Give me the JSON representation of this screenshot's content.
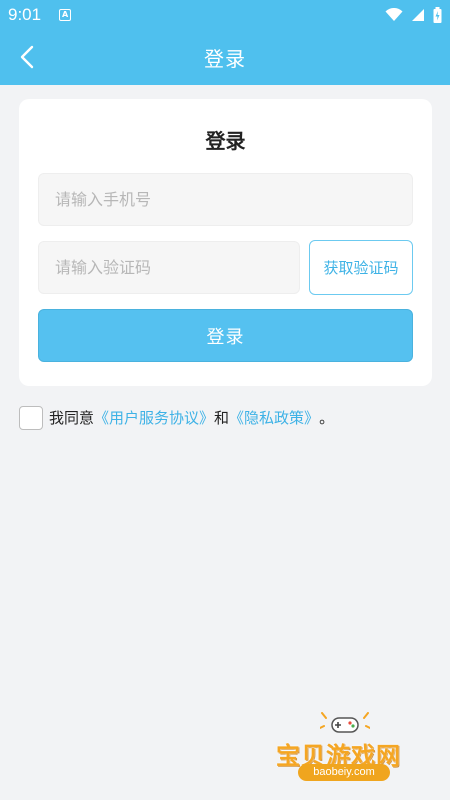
{
  "status_bar": {
    "time": "9:01",
    "notification_icon": "a-notification-icon",
    "icons": [
      "wifi-icon",
      "signal-icon",
      "battery-icon"
    ]
  },
  "app_bar": {
    "title": "登录",
    "back_icon": "chevron-left-icon"
  },
  "card": {
    "title": "登录",
    "phone_placeholder": "请输入手机号",
    "code_placeholder": "请输入验证码",
    "get_code_label": "获取验证码",
    "login_label": "登录"
  },
  "agreement": {
    "prefix": "我同意",
    "user_agreement": "《用户服务协议》",
    "conjunction": "和",
    "privacy_policy": "《隐私政策》",
    "suffix": "。",
    "checked": false
  },
  "watermark": {
    "text": "宝贝游戏网",
    "url": "baobeiy.com"
  },
  "colors": {
    "primary": "#4fc0ee",
    "button": "#55c1f0",
    "link": "#3eb2e6",
    "background": "#f2f3f5"
  }
}
